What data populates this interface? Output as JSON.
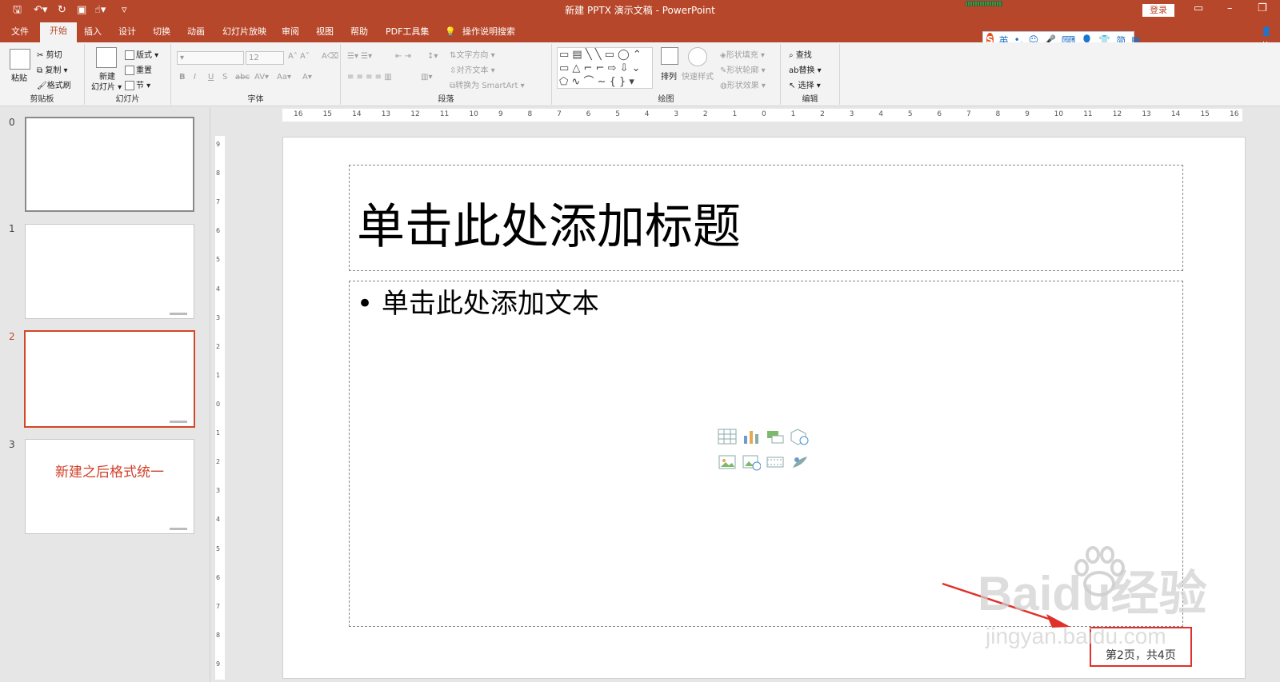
{
  "window": {
    "title": "新建 PPTX 演示文稿 - PowerPoint",
    "login_label": "登录",
    "share_label": "共"
  },
  "tabs": [
    "文件",
    "开始",
    "插入",
    "设计",
    "切换",
    "动画",
    "幻灯片放映",
    "审阅",
    "视图",
    "帮助",
    "PDF工具集",
    "操作说明搜索"
  ],
  "active_tab": "开始",
  "ime": {
    "logo": "S",
    "lang": "英"
  },
  "ribbon": {
    "clipboard": {
      "paste": "粘贴",
      "cut": "剪切",
      "copy": "复制",
      "format_painter": "格式刷",
      "label": "剪贴板"
    },
    "slides": {
      "new_slide": "新建\n幻灯片",
      "new_slide_line1": "新建",
      "new_slide_line2": "幻灯片",
      "layout": "版式",
      "reset": "重置",
      "section": "节",
      "label": "幻灯片"
    },
    "font": {
      "size": "12",
      "label": "字体"
    },
    "paragraph": {
      "text_direction": "文字方向",
      "align_text": "对齐文本",
      "convert_smartart": "转换为 SmartArt",
      "label": "段落"
    },
    "drawing": {
      "arrange": "排列",
      "quick_styles": "快速样式",
      "shape_fill": "形状填充",
      "shape_outline": "形状轮廓",
      "shape_effects": "形状效果",
      "label": "绘图"
    },
    "editing": {
      "find": "查找",
      "replace": "替换",
      "select": "选择",
      "label": "编辑"
    }
  },
  "thumbnails": [
    {
      "number": "0",
      "text": ""
    },
    {
      "number": "1",
      "text": ""
    },
    {
      "number": "2",
      "text": ""
    },
    {
      "number": "3",
      "text": "新建之后格式统一"
    }
  ],
  "selected_slide": "2",
  "slide": {
    "title_placeholder": "单击此处添加标题",
    "body_placeholder": "• 单击此处添加文本",
    "footer_page": "第2页，共4页"
  },
  "ruler": {
    "horizontal": [
      "16",
      "15",
      "14",
      "13",
      "12",
      "11",
      "10",
      "9",
      "8",
      "7",
      "6",
      "5",
      "4",
      "3",
      "2",
      "1",
      "0",
      "1",
      "2",
      "3",
      "4",
      "5",
      "6",
      "7",
      "8",
      "9",
      "10",
      "11",
      "12",
      "13",
      "14",
      "15",
      "16"
    ],
    "vertical": [
      "9",
      "8",
      "7",
      "6",
      "5",
      "4",
      "3",
      "2",
      "1",
      "0",
      "1",
      "2",
      "3",
      "4",
      "5",
      "6",
      "7",
      "8",
      "9"
    ]
  },
  "watermark": {
    "brand": "Baidu经验",
    "url": "jingyan.baidu.com"
  },
  "colors": {
    "accent": "#b7472a",
    "selection": "#d24726",
    "annotation": "#e0302a"
  }
}
